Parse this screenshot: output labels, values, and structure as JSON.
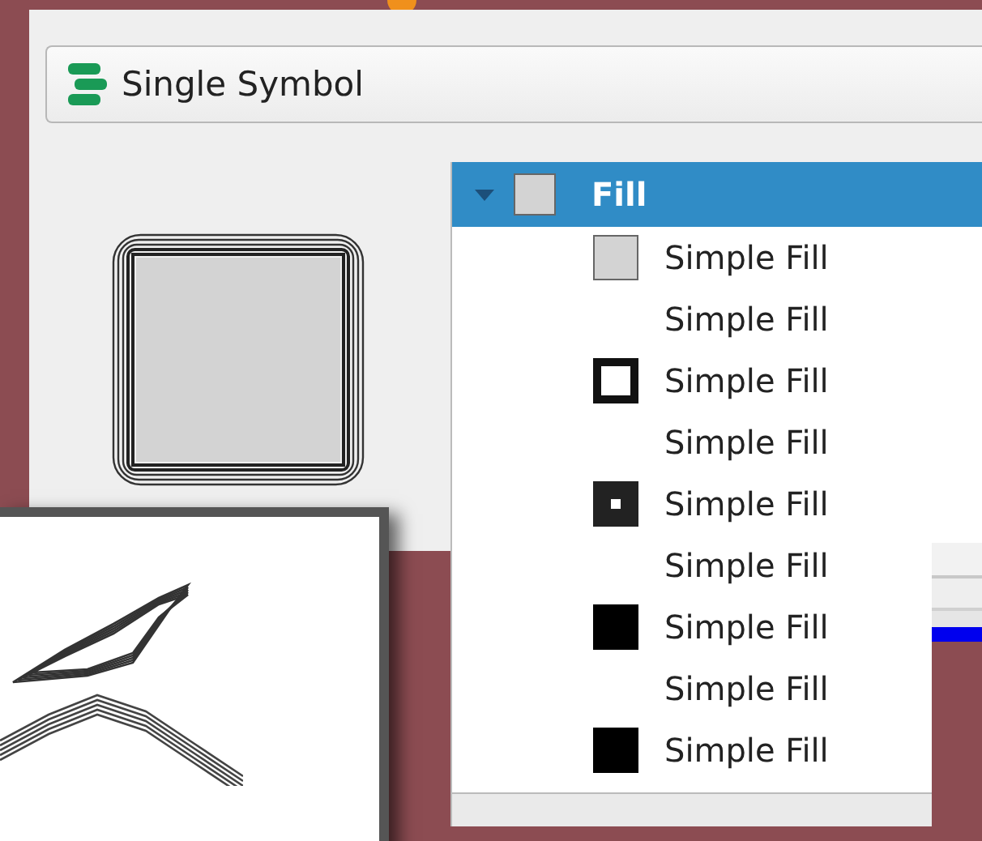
{
  "renderer": {
    "label": "Single Symbol"
  },
  "symbol_tree": {
    "label": "Fill",
    "selected": true,
    "expanded": true,
    "kind": "light",
    "children": [
      {
        "label": "Simple Fill",
        "kind": "light",
        "selected": false
      },
      {
        "label": "Simple Fill",
        "kind": "none",
        "selected": false
      },
      {
        "label": "Simple Fill",
        "kind": "outlined",
        "selected": false
      },
      {
        "label": "Simple Fill",
        "kind": "none",
        "selected": false
      },
      {
        "label": "Simple Fill",
        "kind": "dot",
        "selected": false
      },
      {
        "label": "Simple Fill",
        "kind": "none",
        "selected": false
      },
      {
        "label": "Simple Fill",
        "kind": "solid",
        "selected": false
      },
      {
        "label": "Simple Fill",
        "kind": "none",
        "selected": false
      },
      {
        "label": "Simple Fill",
        "kind": "solid",
        "selected": false
      }
    ]
  }
}
